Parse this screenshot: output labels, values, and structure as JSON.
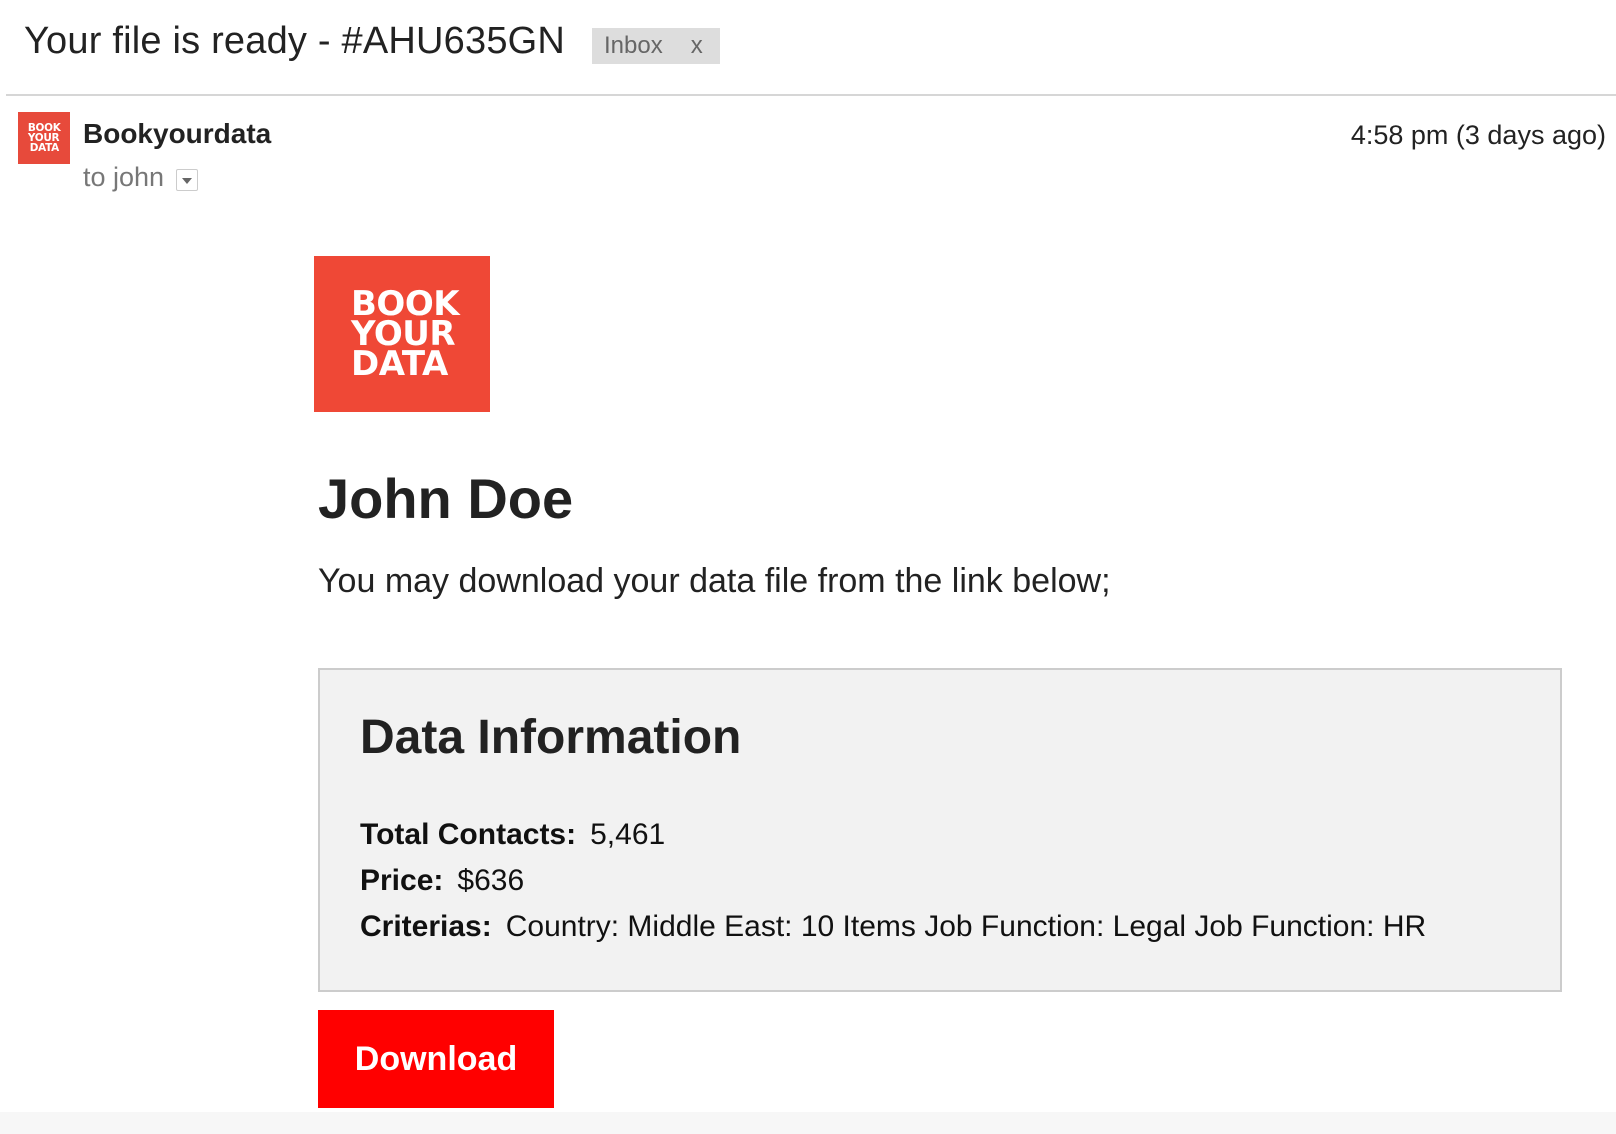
{
  "email": {
    "subject": "Your file is ready - #AHU635GN",
    "label": {
      "text": "Inbox",
      "remove": "x"
    },
    "sender": {
      "name": "Bookyourdata",
      "avatar_lines": [
        "BOOK",
        "YOUR",
        "DATA"
      ]
    },
    "recipient": "to john",
    "timestamp": "4:58 pm (3 days ago)"
  },
  "body": {
    "logo_lines": [
      "BOOK",
      "YOUR",
      "DATA"
    ],
    "greeting": "John Doe",
    "intro": "You may download your data file from the link below;",
    "info": {
      "title": "Data Information",
      "rows": [
        {
          "key": "Total Contacts:",
          "value": "5,461"
        },
        {
          "key": "Price:",
          "value": "$636"
        },
        {
          "key": "Criterias:",
          "value": "Country: Middle East: 10 Items Job Function: Legal Job Function: HR"
        }
      ]
    },
    "download_label": "Download"
  },
  "colors": {
    "brand_red": "#ef4836",
    "button_red": "#ff0000",
    "info_bg": "#f2f2f2"
  }
}
